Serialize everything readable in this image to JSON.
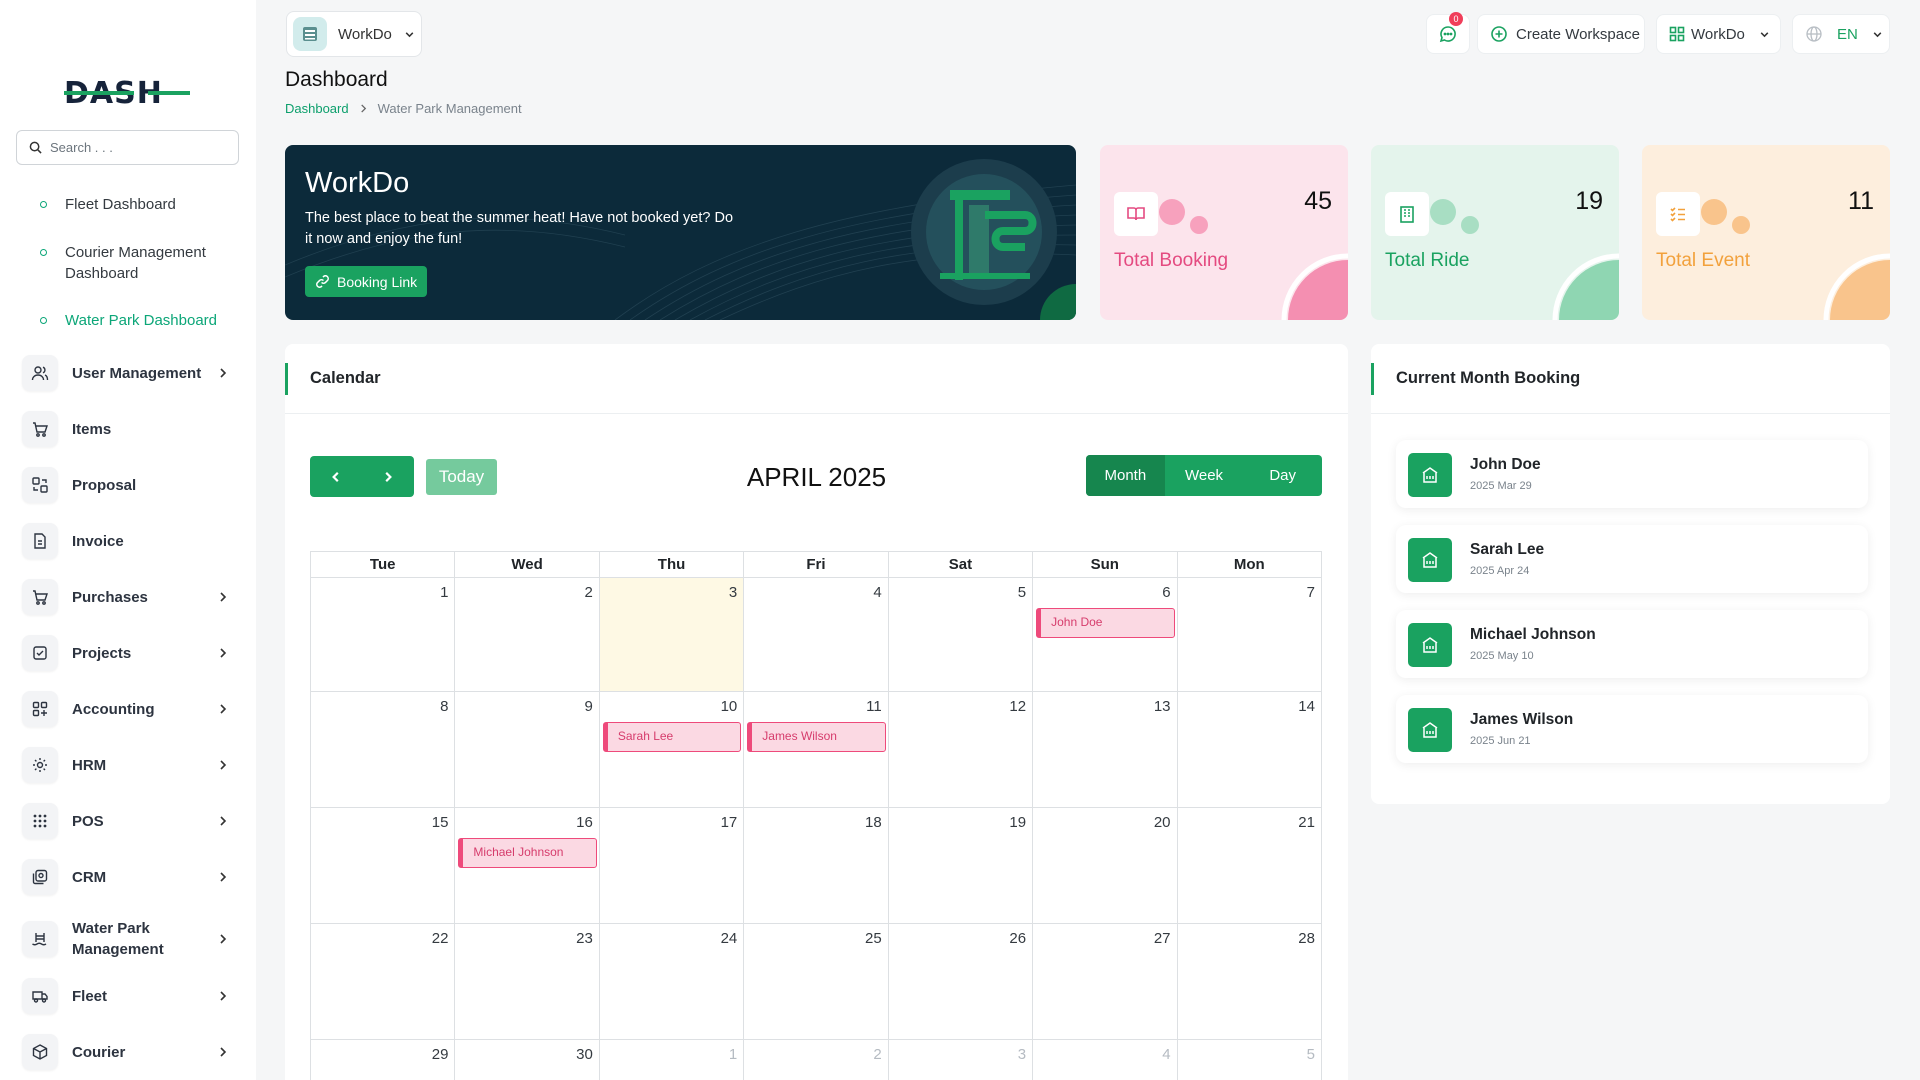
{
  "sidebar": {
    "logo_text": "DASH",
    "search_placeholder": "Search . . .",
    "sub_items": [
      {
        "label": "Fleet Dashboard",
        "active": false
      },
      {
        "label": "Courier Management Dashboard",
        "active": false
      },
      {
        "label": "Water Park Dashboard",
        "active": true
      }
    ],
    "nav": [
      {
        "label": "User Management",
        "icon": "users-icon",
        "chevron": true
      },
      {
        "label": "Items",
        "icon": "cart-icon",
        "chevron": false
      },
      {
        "label": "Proposal",
        "icon": "proposal-icon",
        "chevron": false
      },
      {
        "label": "Invoice",
        "icon": "invoice-icon",
        "chevron": false
      },
      {
        "label": "Purchases",
        "icon": "cart-icon",
        "chevron": true
      },
      {
        "label": "Projects",
        "icon": "checkbox-icon",
        "chevron": true
      },
      {
        "label": "Accounting",
        "icon": "grid-icon",
        "chevron": true
      },
      {
        "label": "HRM",
        "icon": "hrm-icon",
        "chevron": true
      },
      {
        "label": "POS",
        "icon": "dots-grid-icon",
        "chevron": true
      },
      {
        "label": "CRM",
        "icon": "crm-icon",
        "chevron": true
      },
      {
        "label": "Water Park Management",
        "icon": "swim-icon",
        "chevron": true
      },
      {
        "label": "Fleet",
        "icon": "truck-icon",
        "chevron": true
      },
      {
        "label": "Courier",
        "icon": "package-icon",
        "chevron": true
      }
    ]
  },
  "topbar": {
    "workspace_name": "WorkDo",
    "messages_count": "0",
    "create_workspace_label": "Create Workspace",
    "user_workspace_label": "WorkDo",
    "language": "EN"
  },
  "page": {
    "title": "Dashboard",
    "breadcrumb": {
      "root": "Dashboard",
      "current": "Water Park Management"
    }
  },
  "hero": {
    "title": "WorkDo",
    "text": "The best place to beat the summer heat! Have not booked yet? Do it now and enjoy the fun!",
    "button_label": "Booking Link"
  },
  "stats": [
    {
      "label": "Total Booking",
      "value": "45",
      "icon": "book-icon",
      "bg": "#fce4ec",
      "accent": "#f7a1bd",
      "text_color": "#e44a80"
    },
    {
      "label": "Total Ride",
      "value": "19",
      "icon": "building-icon",
      "bg": "#e4f4ec",
      "accent": "#8fd6b2",
      "text_color": "#1aa260"
    },
    {
      "label": "Total Event",
      "value": "11",
      "icon": "list-icon",
      "bg": "#fdeedd",
      "accent": "#f9c48c",
      "text_color": "#f2a13c"
    }
  ],
  "calendar": {
    "panel_title": "Calendar",
    "month_title": "APRIL 2025",
    "today_label": "Today",
    "views": [
      {
        "label": "Month",
        "active": true
      },
      {
        "label": "Week",
        "active": false
      },
      {
        "label": "Day",
        "active": false
      }
    ],
    "weekdays": [
      "Tue",
      "Wed",
      "Thu",
      "Fri",
      "Sat",
      "Sun",
      "Mon"
    ],
    "weeks": [
      [
        {
          "day": "1"
        },
        {
          "day": "2"
        },
        {
          "day": "3",
          "today": true
        },
        {
          "day": "4"
        },
        {
          "day": "5"
        },
        {
          "day": "6",
          "event": "John Doe"
        },
        {
          "day": "7"
        }
      ],
      [
        {
          "day": "8"
        },
        {
          "day": "9"
        },
        {
          "day": "10",
          "event": "Sarah Lee"
        },
        {
          "day": "11",
          "event": "James Wilson"
        },
        {
          "day": "12"
        },
        {
          "day": "13"
        },
        {
          "day": "14"
        }
      ],
      [
        {
          "day": "15"
        },
        {
          "day": "16",
          "event": "Michael Johnson"
        },
        {
          "day": "17"
        },
        {
          "day": "18"
        },
        {
          "day": "19"
        },
        {
          "day": "20"
        },
        {
          "day": "21"
        }
      ],
      [
        {
          "day": "22"
        },
        {
          "day": "23"
        },
        {
          "day": "24"
        },
        {
          "day": "25"
        },
        {
          "day": "26"
        },
        {
          "day": "27"
        },
        {
          "day": "28"
        }
      ],
      [
        {
          "day": "29"
        },
        {
          "day": "30"
        },
        {
          "day": "1",
          "other": true
        },
        {
          "day": "2",
          "other": true
        },
        {
          "day": "3",
          "other": true
        },
        {
          "day": "4",
          "other": true
        },
        {
          "day": "5",
          "other": true
        }
      ]
    ]
  },
  "bookings": {
    "panel_title": "Current Month Booking",
    "items": [
      {
        "name": "John Doe",
        "date": "2025 Mar 29"
      },
      {
        "name": "Sarah Lee",
        "date": "2025 Apr 24"
      },
      {
        "name": "Michael Johnson",
        "date": "2025 May 10"
      },
      {
        "name": "James Wilson",
        "date": "2025 Jun 21"
      }
    ]
  },
  "colors": {
    "primary": "#1aa260",
    "primary_dark": "#16864e",
    "hero_bg": "#0c2a3a",
    "event_border": "#ee4a7b"
  }
}
